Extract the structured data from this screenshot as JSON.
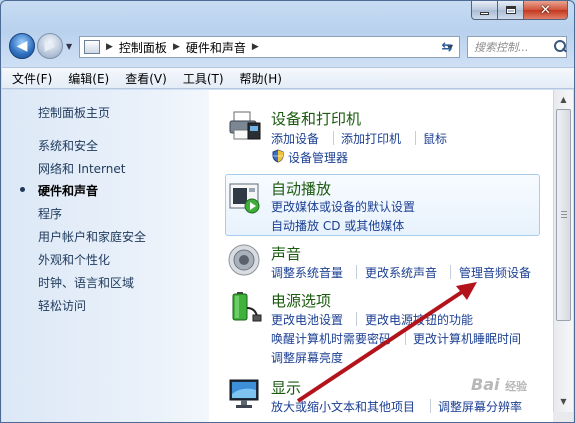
{
  "window": {
    "caption_buttons": {
      "minimize": "",
      "maximize": "",
      "close": "✕"
    }
  },
  "nav": {
    "breadcrumb": [
      "控制面板",
      "硬件和声音"
    ],
    "search_placeholder": "搜索控制..."
  },
  "menu": [
    "文件(F)",
    "编辑(E)",
    "查看(V)",
    "工具(T)",
    "帮助(H)"
  ],
  "left_pane": {
    "items": [
      "控制面板主页",
      "系统和安全",
      "网络和 Internet",
      "硬件和声音",
      "程序",
      "用户帐户和家庭安全",
      "外观和个性化",
      "时钟、语言和区域",
      "轻松访问"
    ],
    "active": "硬件和声音"
  },
  "categories": {
    "devices": {
      "title": "设备和打印机",
      "links": [
        "添加设备",
        "添加打印机",
        "鼠标"
      ],
      "sub_link": "设备管理器",
      "icon": "printer-icon"
    },
    "autoplay": {
      "title": "自动播放",
      "links": [
        "更改媒体或设备的默认设置",
        "自动播放 CD 或其他媒体"
      ],
      "icon": "autoplay-icon"
    },
    "sound": {
      "title": "声音",
      "links": [
        "调整系统音量",
        "更改系统声音",
        "管理音频设备"
      ],
      "icon": "speaker-icon"
    },
    "power": {
      "title": "电源选项",
      "links": [
        "更改电池设置",
        "更改电源按钮的功能",
        "唤醒计算机时需要密码",
        "更改计算机睡眠时间",
        "调整屏幕亮度"
      ],
      "icon": "battery-icon"
    },
    "display": {
      "title": "显示",
      "links": [
        "放大或缩小文本和其他项目",
        "调整屏幕分辨率"
      ],
      "icon": "monitor-icon"
    }
  },
  "watermark": {
    "text": "Bai",
    "suffix": "经验"
  },
  "colors": {
    "link": "#1b3f93",
    "category_title": "#1b5a0f",
    "arrow": "#b3141c"
  }
}
